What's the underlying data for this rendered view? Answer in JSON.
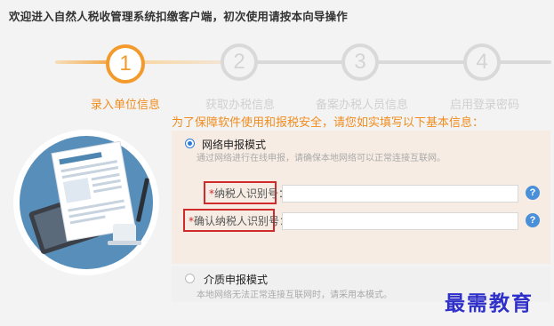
{
  "window": {
    "title": "欢迎进入自然人税收管理系统扣缴客户端，初次使用请按本向导操作"
  },
  "wizard": {
    "steps": [
      {
        "number": "1",
        "label": "录入单位信息",
        "state": "active"
      },
      {
        "number": "2",
        "label": "获取办税信息",
        "state": "inactive"
      },
      {
        "number": "3",
        "label": "备案办税人员信息",
        "state": "inactive"
      },
      {
        "number": "4",
        "label": "启用登录密码",
        "state": "inactive"
      }
    ],
    "hint": "为了保障软件使用和报税安全，请您如实填写以下基本信息：",
    "active_color": "#f39a2c"
  },
  "form": {
    "network_mode": {
      "title": "网络申报模式",
      "desc": "通过网络进行在线申报，请确保本地网络可以正常连接互联网。",
      "selected": true
    },
    "taxpayer_id": {
      "required_mark": "*",
      "label": "纳税人识别号：",
      "value": ""
    },
    "confirm_taxpayer_id": {
      "required_mark": "*",
      "label": "确认纳税人识别号：",
      "value": ""
    },
    "help_label": "?",
    "media_mode": {
      "title": "介质申报模式",
      "desc": "本地网络无法正常连接互联网时，请采用本模式。",
      "selected": false
    }
  },
  "watermark": "最需教育",
  "colors": {
    "highlight_border": "#d12a2a",
    "radio_selected": "#2d7bd6",
    "help_icon": "#4a90d9"
  }
}
